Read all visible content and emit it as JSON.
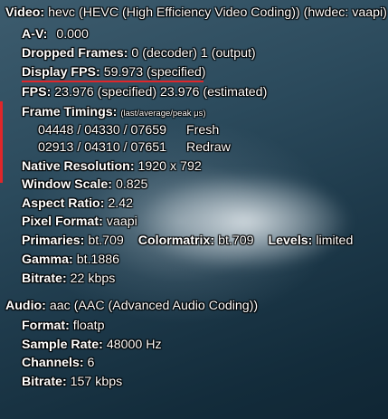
{
  "video": {
    "header_key": "Video:",
    "header_value": "hevc (HEVC (High Efficiency Video Coding)) (hwdec: vaapi)",
    "av_key": "A-V:",
    "av_value": "0.000",
    "dropped_key": "Dropped Frames:",
    "dropped_value": "0 (decoder)  1 (output)",
    "display_fps_key": "Display FPS:",
    "display_fps_value": "59.973 (specified)",
    "fps_key": "FPS:",
    "fps_value": "23.976 (specified)  23.976 (estimated)",
    "frame_timings_key": "Frame Timings:",
    "frame_timings_note": "(last/average/peak  μs)",
    "fresh_values": "04448 / 04330 / 07659",
    "fresh_label": "Fresh",
    "redraw_values": "02913 / 04310 / 07651",
    "redraw_label": "Redraw",
    "native_res_key": "Native Resolution:",
    "native_res_value": "1920 x 792",
    "window_scale_key": "Window Scale:",
    "window_scale_value": "0.825",
    "aspect_key": "Aspect Ratio:",
    "aspect_value": "2.42",
    "pixel_format_key": "Pixel Format:",
    "pixel_format_value": "vaapi",
    "primaries_key": "Primaries:",
    "primaries_value": "bt.709",
    "colormatrix_key": "Colormatrix:",
    "colormatrix_value": "bt.709",
    "levels_key": "Levels:",
    "levels_value": "limited",
    "gamma_key": "Gamma:",
    "gamma_value": "bt.1886",
    "bitrate_key": "Bitrate:",
    "bitrate_value": "22 kbps"
  },
  "audio": {
    "header_key": "Audio:",
    "header_value": "aac (AAC (Advanced Audio Coding))",
    "format_key": "Format:",
    "format_value": "floatp",
    "sample_rate_key": "Sample Rate:",
    "sample_rate_value": "48000 Hz",
    "channels_key": "Channels:",
    "channels_value": "6",
    "bitrate_key": "Bitrate:",
    "bitrate_value": "157 kbps"
  },
  "colors": {
    "text": "#ffffff",
    "highlight": "#e0262a",
    "background": "#1e3a4b"
  }
}
